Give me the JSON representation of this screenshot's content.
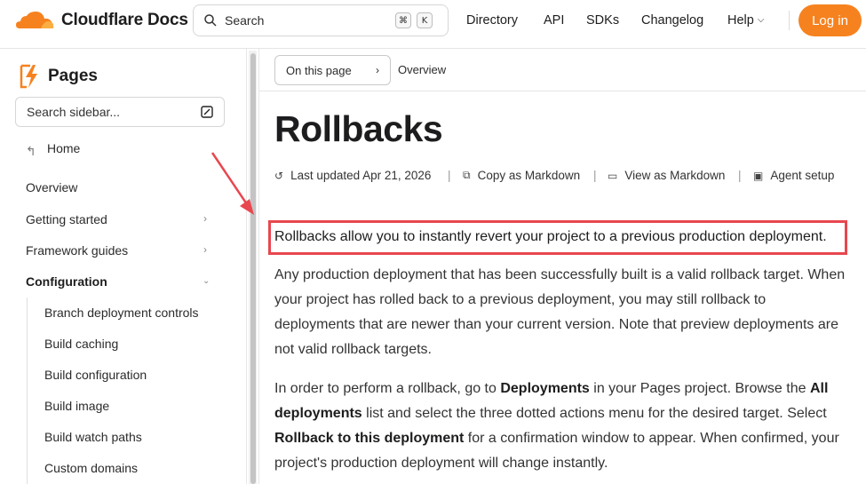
{
  "header": {
    "brand": "Cloudflare Docs",
    "search_placeholder": "Search",
    "search_kbd": [
      "⌘",
      "K"
    ],
    "nav": [
      "Directory",
      "API",
      "SDKs",
      "Changelog",
      "Help"
    ],
    "login": "Log in"
  },
  "sidebar": {
    "product": "Pages",
    "search_placeholder": "Search sidebar...",
    "home": "Home",
    "items": [
      "Overview",
      "Getting started",
      "Framework guides",
      "Configuration"
    ],
    "config_children": [
      "Branch deployment controls",
      "Build caching",
      "Build configuration",
      "Build image",
      "Build watch paths",
      "Custom domains"
    ]
  },
  "main": {
    "on_this_page": "On this page",
    "current_section": "Overview",
    "title": "Rollbacks",
    "meta": {
      "last_updated": "Last updated Apr 21, 2026",
      "copy_markdown": "Copy as Markdown",
      "view_markdown": "View as Markdown",
      "agent_setup": "Agent setup"
    },
    "lead": "Rollbacks allow you to instantly revert your project to a previous production deployment.",
    "para2_lines": [
      "Any production deployment that has been successfully built is a valid rollback target. When",
      "your project has rolled back to a previous deployment, you may still rollback to",
      "deployments that are newer than your current version. Note that preview deployments are",
      "not valid rollback targets."
    ],
    "para3": {
      "l1a": "In order to perform a rollback, go to ",
      "l1b": "Deployments",
      "l1c": " in your Pages project. Browse the ",
      "l1d": "All",
      "l2a": "deployments",
      "l2b": " list and select the three dotted actions menu for the desired target. Select",
      "l3a": "Rollback to this deployment",
      "l3b": " for a confirmation window to appear. When confirmed, your",
      "l4": "project's production deployment will change instantly."
    }
  },
  "colors": {
    "accent": "#f6821f",
    "highlight": "#e8474f"
  }
}
